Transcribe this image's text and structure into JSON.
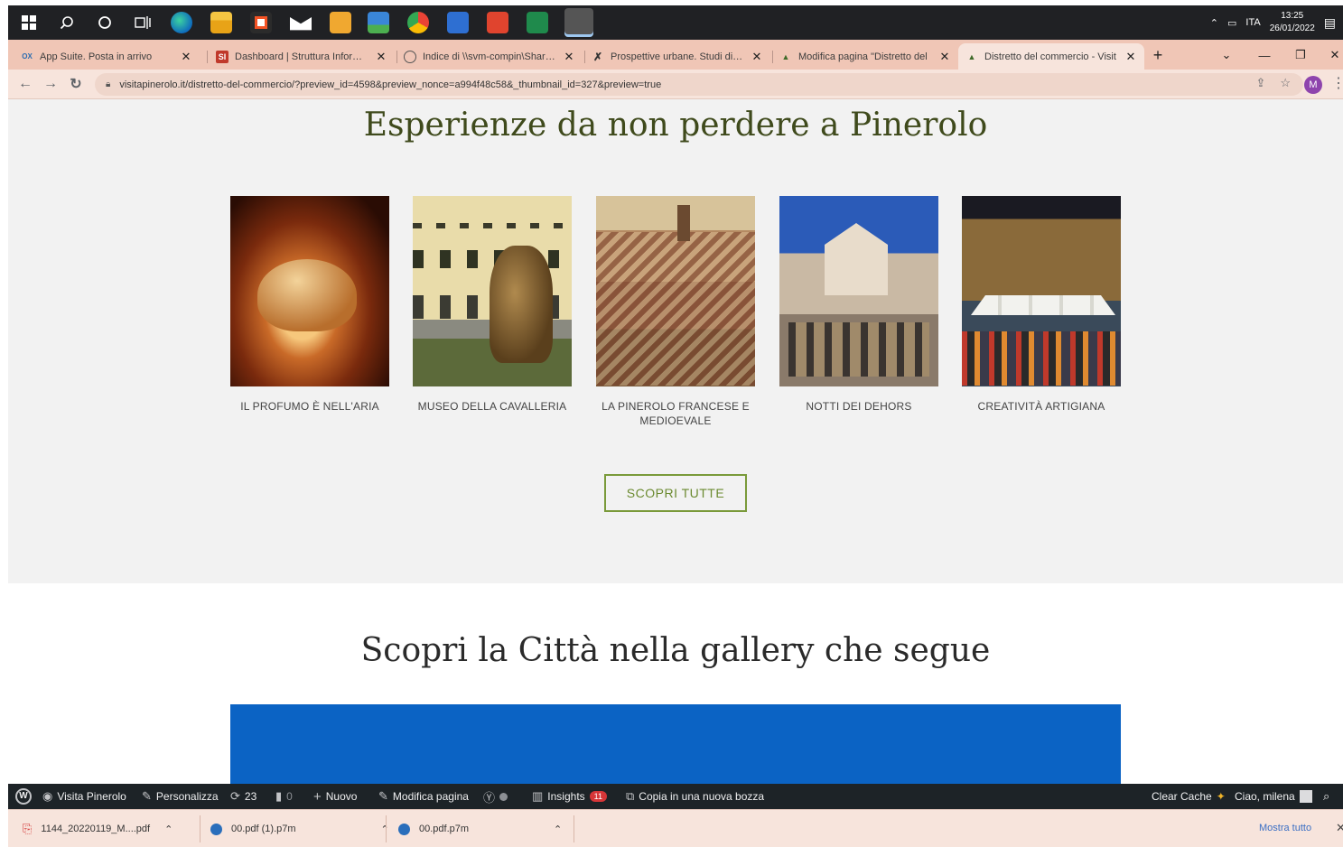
{
  "taskbar": {
    "apps": [
      "start",
      "search",
      "cortana",
      "task-view",
      "edge",
      "explorer",
      "store",
      "mail",
      "media",
      "photos",
      "chrome",
      "outlook",
      "acrobat",
      "excel",
      "chrome-profile"
    ],
    "tray_lang": "ITA",
    "time": "13:25",
    "date": "26/01/2022"
  },
  "tabs": [
    {
      "title": "App Suite. Posta in arrivo",
      "icon": "ox-icon",
      "active": false
    },
    {
      "title": "Dashboard | Struttura Informati",
      "icon": "si-icon",
      "active": false
    },
    {
      "title": "Indice di \\\\svm-compin\\Shares\\",
      "icon": "globe-icon",
      "active": false
    },
    {
      "title": "Prospettive urbane. Studi di fatt",
      "icon": "x-logo-icon",
      "active": false
    },
    {
      "title": "Modifica pagina \"Distretto del",
      "icon": "site-icon",
      "active": false
    },
    {
      "title": "Distretto del commercio - Visit",
      "icon": "site-icon",
      "active": true
    }
  ],
  "address": {
    "url": "visitapinerolo.it/distretto-del-commercio/?preview_id=4598&preview_nonce=a994f48c58&_thumbnail_id=327&preview=true",
    "avatar_letter": "M"
  },
  "experiences": {
    "title": "Esperienze da non perdere a Pinerolo",
    "cards": [
      {
        "caption": "IL PROFUMO È NELL'ARIA"
      },
      {
        "caption": "MUSEO DELLA CAVALLERIA"
      },
      {
        "caption": "LA PINEROLO FRANCESE E MEDIOEVALE"
      },
      {
        "caption": "NOTTI DEI DEHORS"
      },
      {
        "caption": "CREATIVITÀ ARTIGIANA"
      }
    ],
    "button": "SCOPRI TUTTE"
  },
  "gallery": {
    "title": "Scopri la Città nella gallery che segue"
  },
  "adminbar": {
    "site": "Visita Pinerolo",
    "customize": "Personalizza",
    "updates": "23",
    "comments": "0",
    "new": "Nuovo",
    "edit": "Modifica pagina",
    "insights": "Insights",
    "insights_badge": "11",
    "copy": "Copia in una nuova bozza",
    "clear_cache": "Clear Cache",
    "greeting": "Ciao, milena"
  },
  "downloads": {
    "items": [
      {
        "name": "1144_20220119_M....pdf"
      },
      {
        "name": "00.pdf (1).p7m"
      },
      {
        "name": "00.pdf.p7m"
      }
    ],
    "show_all": "Mostra tutto"
  }
}
